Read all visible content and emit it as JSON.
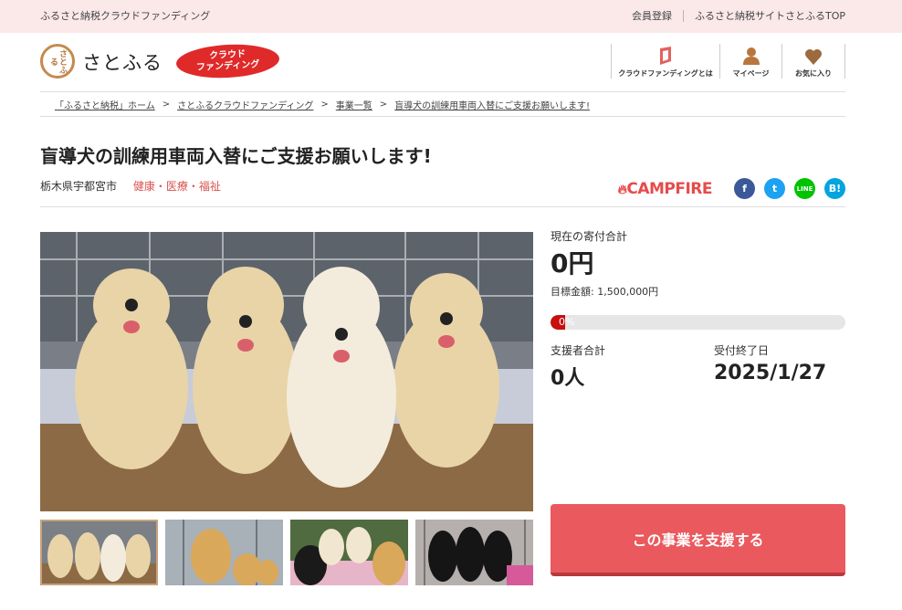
{
  "topbar": {
    "site_name": "ふるさと納税クラウドファンディング",
    "register": "会員登録",
    "satofull_top": "ふるさと納税サイトさとふるTOP"
  },
  "header": {
    "logo_mark": "さとふる",
    "logo_text": "さとふる",
    "cf_badge_line1": "クラウド",
    "cf_badge_line2": "ファンディング",
    "nav": [
      {
        "label": "クラウドファンディングとは",
        "icon": "book-icon"
      },
      {
        "label": "マイページ",
        "icon": "user-icon"
      },
      {
        "label": "お気に入り",
        "icon": "heart-icon"
      }
    ]
  },
  "breadcrumb": [
    "「ふるさと納税」ホーム",
    "さとふるクラウドファンディング",
    "事業一覧",
    "盲導犬の訓練用車両入替にご支援お願いします!"
  ],
  "project": {
    "title": "盲導犬の訓練用車両入替にご支援お願いします!",
    "location": "栃木県宇都宮市",
    "category": "健康・医療・福祉"
  },
  "share": {
    "campfire": "CAMPFIRE",
    "buttons": [
      {
        "label": "f",
        "icon": "facebook-icon",
        "color": "#3b5998"
      },
      {
        "label": "t",
        "icon": "twitter-icon",
        "color": "#1da1f2"
      },
      {
        "label": "LINE",
        "icon": "line-icon",
        "color": "#00c300"
      },
      {
        "label": "B!",
        "icon": "hatena-icon",
        "color": "#00a4de"
      }
    ]
  },
  "stats": {
    "total_label": "現在の寄付合計",
    "total_value": "0円",
    "goal": "目標金額: 1,500,000円",
    "progress_text": "0%",
    "progress_fraction": 0,
    "supporters_label": "支援者合計",
    "supporters_value": "0人",
    "deadline_label": "受付終了日",
    "deadline_value": "2025/1/27"
  },
  "cta": {
    "support_label": "この事業を支援する"
  },
  "colors": {
    "accent": "#e9595d",
    "topbar": "#fbe9ea",
    "category": "#d9534f"
  }
}
